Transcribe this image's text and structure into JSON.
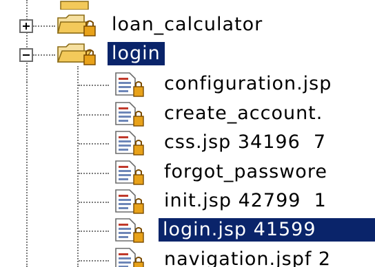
{
  "tree": {
    "folders": [
      {
        "label": "loan_calculator",
        "expanded": false,
        "selected": false
      },
      {
        "label": "login",
        "expanded": true,
        "selected": true
      }
    ],
    "files": [
      {
        "label": "configuration.jsp",
        "selected": false
      },
      {
        "label": "create_account.",
        "selected": false
      },
      {
        "label": "css.jsp 34196  7",
        "selected": false
      },
      {
        "label": "forgot_passwore",
        "selected": false
      },
      {
        "label": "init.jsp 42799  1",
        "selected": false
      },
      {
        "label": "login.jsp 41599 ",
        "selected": true
      },
      {
        "label": "navigation.jspf 2",
        "selected": false
      }
    ]
  },
  "colors": {
    "selection_background": "#0a246a",
    "selection_text": "#ffffff",
    "folder": "#f3c95a",
    "file_icon_blue": "#6d86b8",
    "file_icon_red": "#c0392b",
    "lock": "#e8a21a"
  },
  "icons": {
    "folder": "folder-icon",
    "file": "jsp-file-icon",
    "lock": "lock-icon",
    "expand": "plus-icon",
    "collapse": "minus-icon"
  }
}
